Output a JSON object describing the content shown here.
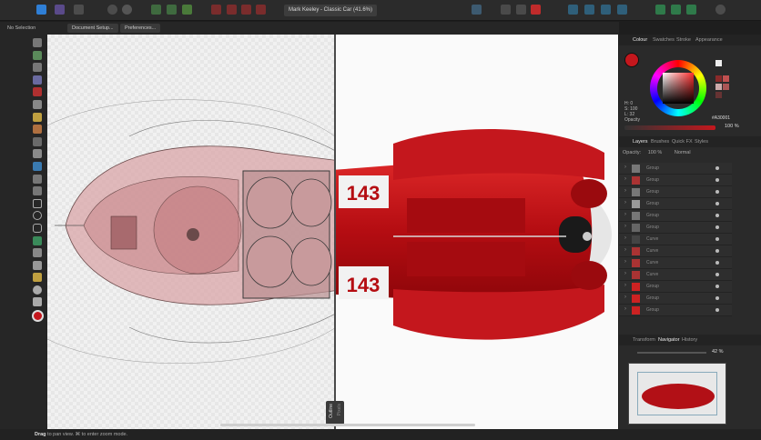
{
  "toolbar": {
    "document_title": "Mark Keeley - Classic Car (41.6%)"
  },
  "context_bar": {
    "selection_label": "No Selection",
    "document_setup_label": "Document Setup...",
    "preferences_label": "Preferences..."
  },
  "canvas": {
    "split_left_label": "Outline",
    "split_right_label": "Pixels",
    "car_number": "143"
  },
  "status": {
    "prefix": "Drag",
    "text": " to pan view. ⌘ to enter zoom mode."
  },
  "color_panel": {
    "tabs": [
      "Colour",
      "Swatches",
      "Stroke",
      "Appearance"
    ],
    "h": "H: 0",
    "s": "S: 100",
    "l": "L: 32",
    "opacity_label": "Opacity",
    "hex": "A30001",
    "opacity_value": "100 %",
    "fill_color": "#c4171d"
  },
  "layers_panel": {
    "tabs": [
      "Layers",
      "Brushes",
      "Quick FX",
      "Styles"
    ],
    "opacity_label": "Opacity:",
    "opacity_value": "100 %",
    "blend_mode": "Normal",
    "rows": [
      "Group",
      "Group",
      "Group",
      "Group",
      "Group",
      "Group",
      "Curve",
      "Curve",
      "Curve",
      "Curve",
      "Group",
      "Group",
      "Group"
    ]
  },
  "navigator_panel": {
    "tabs": [
      "Transform",
      "Navigator",
      "History"
    ],
    "zoom": "42 %"
  }
}
